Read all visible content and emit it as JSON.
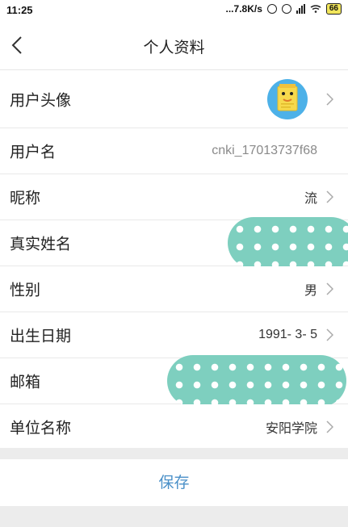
{
  "status_bar": {
    "time": "11:25",
    "network_speed": "...7.8K/s",
    "battery": "66"
  },
  "header": {
    "title": "个人资料",
    "back_icon": "chevron-left-icon"
  },
  "rows": [
    {
      "label": "用户头像",
      "value": "",
      "type": "avatar"
    },
    {
      "label": "用户名",
      "value": "cnki_17013737f68",
      "type": "readonly"
    },
    {
      "label": "昵称",
      "value": "流",
      "type": "link"
    },
    {
      "label": "真实姓名",
      "value": "",
      "type": "redacted"
    },
    {
      "label": "性别",
      "value": "男",
      "type": "link"
    },
    {
      "label": "出生日期",
      "value": "1991- 3- 5",
      "type": "link"
    },
    {
      "label": "邮箱",
      "value": "",
      "type": "redacted"
    },
    {
      "label": "单位名称",
      "value": "安阳学院",
      "type": "link"
    }
  ],
  "save_label": "保存",
  "colors": {
    "accent": "#4a90c8",
    "redaction": "#7ecfbf",
    "avatar_bg": "#4db1e8"
  }
}
